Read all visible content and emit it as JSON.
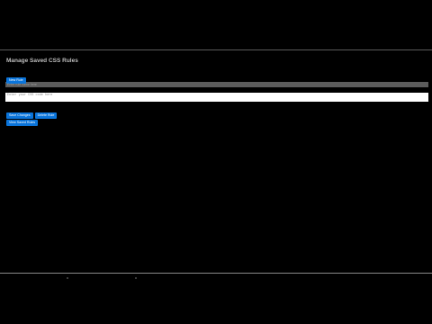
{
  "manager": {
    "title": "Manage Saved CSS Rules",
    "new_rule_label": "New Rule",
    "name_placeholder": "Enter rule name here",
    "code_placeholder": "Enter your CSS code here",
    "save_label": "Save Changes",
    "delete_label": "Delete Rule",
    "view_saved_label": "View Saved Rules"
  },
  "colors": {
    "background": "#000000",
    "button_blue": "#0a74da",
    "title_text": "#bdbdbd"
  }
}
